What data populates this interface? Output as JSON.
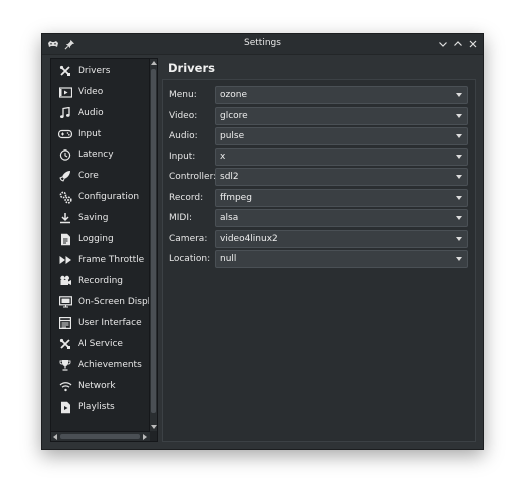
{
  "window": {
    "title": "Settings",
    "icons": [
      "app-icon",
      "pin-icon"
    ],
    "controls": [
      "minimize-icon",
      "maximize-icon",
      "close-icon"
    ]
  },
  "sidebar": {
    "items": [
      {
        "label": "Drivers",
        "icon": "drivers-icon"
      },
      {
        "label": "Video",
        "icon": "video-icon"
      },
      {
        "label": "Audio",
        "icon": "audio-icon"
      },
      {
        "label": "Input",
        "icon": "input-icon"
      },
      {
        "label": "Latency",
        "icon": "latency-icon"
      },
      {
        "label": "Core",
        "icon": "core-icon"
      },
      {
        "label": "Configuration",
        "icon": "configuration-icon"
      },
      {
        "label": "Saving",
        "icon": "saving-icon"
      },
      {
        "label": "Logging",
        "icon": "logging-icon"
      },
      {
        "label": "Frame Throttle",
        "icon": "frame-throttle-icon"
      },
      {
        "label": "Recording",
        "icon": "recording-icon"
      },
      {
        "label": "On-Screen Display",
        "icon": "on-screen-display-icon"
      },
      {
        "label": "User Interface",
        "icon": "user-interface-icon"
      },
      {
        "label": "AI Service",
        "icon": "ai-service-icon"
      },
      {
        "label": "Achievements",
        "icon": "achievements-icon"
      },
      {
        "label": "Network",
        "icon": "network-icon"
      },
      {
        "label": "Playlists",
        "icon": "playlists-icon"
      }
    ]
  },
  "main": {
    "title": "Drivers",
    "rows": [
      {
        "label": "Menu:",
        "value": "ozone"
      },
      {
        "label": "Video:",
        "value": "glcore"
      },
      {
        "label": "Audio:",
        "value": "pulse"
      },
      {
        "label": "Input:",
        "value": "x"
      },
      {
        "label": "Controller:",
        "value": "sdl2"
      },
      {
        "label": "Record:",
        "value": "ffmpeg"
      },
      {
        "label": "MIDI:",
        "value": "alsa"
      },
      {
        "label": "Camera:",
        "value": "video4linux2"
      },
      {
        "label": "Location:",
        "value": "null"
      }
    ]
  },
  "colors": {
    "window_bg": "#2f3336",
    "sidebar_bg": "#202326",
    "panel_bg": "#2a2e31",
    "combo_bg": "#3a3f43",
    "text": "#e8e8e8"
  }
}
